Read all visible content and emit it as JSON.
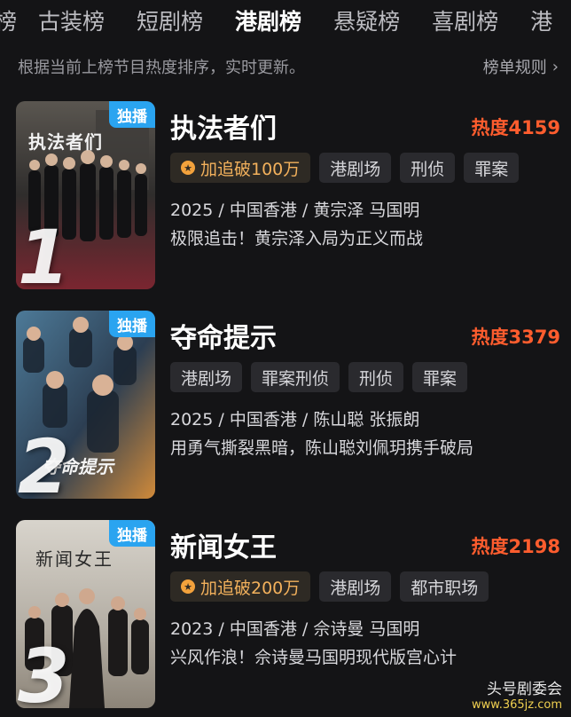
{
  "tabs": [
    "榜",
    "古装榜",
    "短剧榜",
    "港剧榜",
    "悬疑榜",
    "喜剧榜",
    "港"
  ],
  "active_tab": 3,
  "subbar": {
    "hint": "根据当前上榜节目热度排序，实时更新。",
    "rules": "榜单规则"
  },
  "items": [
    {
      "badge": "独播",
      "rank": "1",
      "poster_title": "执法者们",
      "title": "执法者们",
      "heat": "热度4159",
      "tags": [
        "加追破100万",
        "港剧场",
        "刑侦",
        "罪案"
      ],
      "meta": "2025 / 中国香港 / 黄宗泽 马国明",
      "desc": "极限追击！黄宗泽入局为正义而战"
    },
    {
      "badge": "独播",
      "rank": "2",
      "poster_title": "夺命提示",
      "title": "夺命提示",
      "heat": "热度3379",
      "tags": [
        "港剧场",
        "罪案刑侦",
        "刑侦",
        "罪案"
      ],
      "meta": "2025 / 中国香港 / 陈山聪 张振朗",
      "desc": "用勇气撕裂黑暗，陈山聪刘佩玥携手破局"
    },
    {
      "badge": "独播",
      "rank": "3",
      "poster_title": "新闻女王",
      "title": "新闻女王",
      "heat": "热度2198",
      "tags": [
        "加追破200万",
        "港剧场",
        "都市职场"
      ],
      "meta": "2023 / 中国香港 / 佘诗曼 马国明",
      "desc": "兴风作浪！佘诗曼马国明现代版宫心计"
    }
  ],
  "watermark": {
    "line1": "头号剧委会",
    "line2": "www.365jz.com"
  },
  "colors": {
    "background": "#141416",
    "heat": "#ff5d2e",
    "badge": "#2aa4f0",
    "follow_tag": "#f3b15c"
  }
}
